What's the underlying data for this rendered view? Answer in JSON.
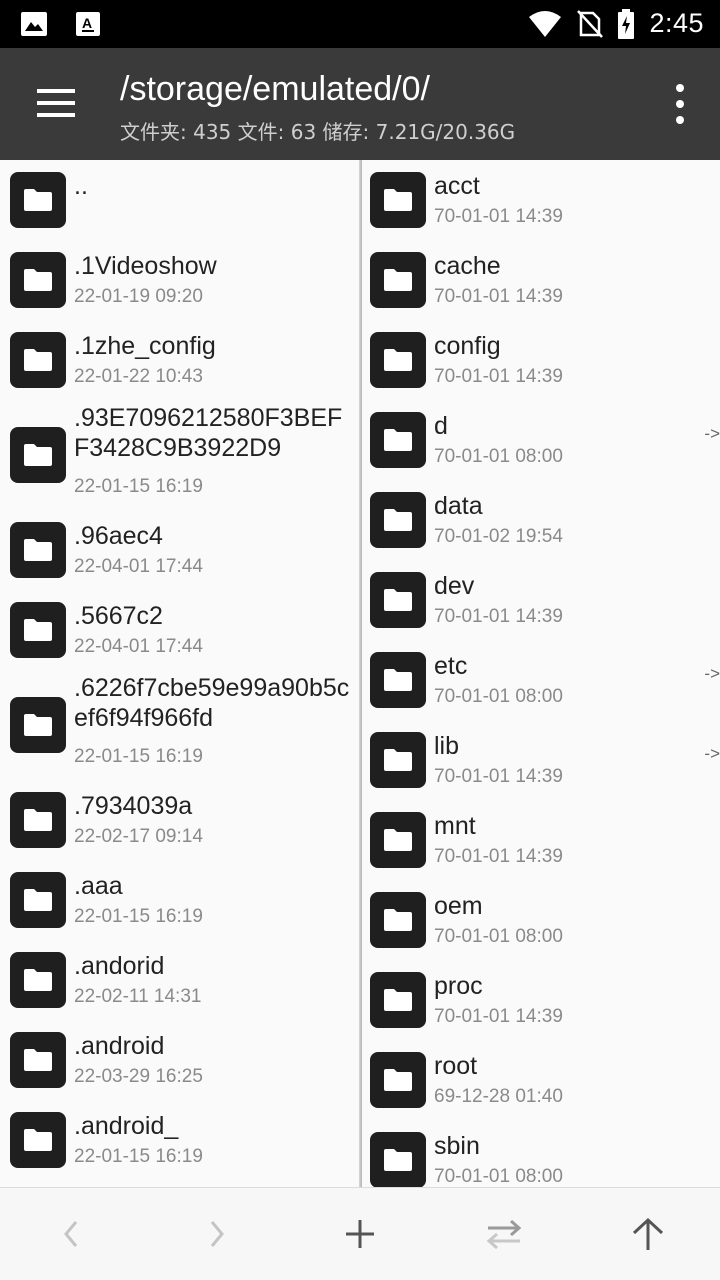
{
  "status_bar": {
    "time": "2:45",
    "left_icons": [
      "image-notification-icon",
      "text-notification-icon"
    ],
    "right_icons": [
      "wifi-icon",
      "no-sim-icon",
      "battery-charging-icon"
    ]
  },
  "toolbar": {
    "path": "/storage/emulated/0/",
    "summary": "文件夹: 435  文件: 63  储存: 7.21G/20.36G"
  },
  "left_pane": {
    "items": [
      {
        "name": "..",
        "date": ""
      },
      {
        "name": ".1Videoshow",
        "date": "22-01-19 09:20"
      },
      {
        "name": ".1zhe_config",
        "date": "22-01-22 10:43"
      },
      {
        "name": ".93E7096212580F3BEFF3428C9B3922D9",
        "date": "22-01-15 16:19"
      },
      {
        "name": ".96aec4",
        "date": "22-04-01 17:44"
      },
      {
        "name": ".5667c2",
        "date": "22-04-01 17:44"
      },
      {
        "name": ".6226f7cbe59e99a90b5cef6f94f966fd",
        "date": "22-01-15 16:19"
      },
      {
        "name": ".7934039a",
        "date": "22-02-17 09:14"
      },
      {
        "name": ".aaa",
        "date": "22-01-15 16:19"
      },
      {
        "name": ".andorid",
        "date": "22-02-11 14:31"
      },
      {
        "name": ".android",
        "date": "22-03-29 16:25"
      },
      {
        "name": ".android_",
        "date": "22-01-15 16:19"
      }
    ]
  },
  "right_pane": {
    "link_marker": "->",
    "items": [
      {
        "name": "acct",
        "date": "70-01-01 14:39"
      },
      {
        "name": "cache",
        "date": "70-01-01 14:39"
      },
      {
        "name": "config",
        "date": "70-01-01 14:39"
      },
      {
        "name": "d",
        "date": "70-01-01 08:00"
      },
      {
        "name": "data",
        "date": "70-01-02 19:54"
      },
      {
        "name": "dev",
        "date": "70-01-01 14:39"
      },
      {
        "name": "etc",
        "date": "70-01-01 08:00"
      },
      {
        "name": "lib",
        "date": "70-01-01 14:39"
      },
      {
        "name": "mnt",
        "date": "70-01-01 14:39"
      },
      {
        "name": "oem",
        "date": "70-01-01 08:00"
      },
      {
        "name": "proc",
        "date": "70-01-01 14:39"
      },
      {
        "name": "root",
        "date": "69-12-28 01:40"
      },
      {
        "name": "sbin",
        "date": "70-01-01 08:00"
      }
    ]
  },
  "bottom_bar": {
    "buttons": [
      "back-icon",
      "forward-icon",
      "add-icon",
      "swap-icon",
      "up-icon"
    ]
  },
  "colors": {
    "toolbar": "#3a3a3a",
    "status_bar": "#000000",
    "folder_icon_bg": "#1f1f1f",
    "date_text": "#8a8a8a"
  }
}
